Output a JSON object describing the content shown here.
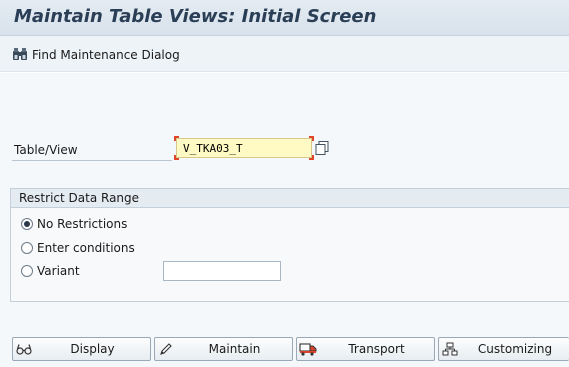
{
  "title": "Maintain Table Views: Initial Screen",
  "toolbar": {
    "find_label": "Find Maintenance Dialog",
    "find_icon": "binoculars-icon"
  },
  "table_view": {
    "label": "Table/View",
    "value": "V_TKA03_T"
  },
  "restrict": {
    "title": "Restrict Data Range",
    "options": [
      {
        "label": "No Restrictions",
        "selected": true
      },
      {
        "label": "Enter conditions",
        "selected": false
      },
      {
        "label": "Variant",
        "selected": false
      }
    ],
    "variant_value": ""
  },
  "actions": [
    {
      "label": "Display",
      "icon": "glasses-icon"
    },
    {
      "label": "Maintain",
      "icon": "pencil-icon"
    },
    {
      "label": "Transport",
      "icon": "truck-icon"
    },
    {
      "label": "Customizing",
      "icon": "hierarchy-icon"
    }
  ],
  "colors": {
    "title_text": "#2a3f56",
    "input_bg": "#fff9c4",
    "required_marker": "#e0452b"
  }
}
